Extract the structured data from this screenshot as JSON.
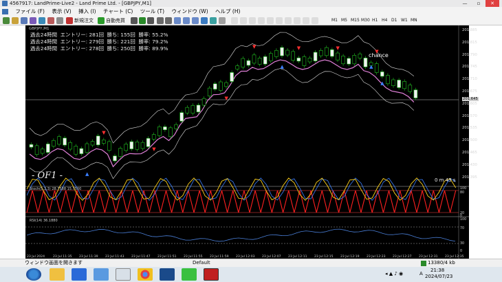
{
  "window": {
    "title": "4567917: LandPrime-Live2 - Land Prime Ltd. - [GBPJPY,M1]",
    "minimize": "—",
    "maximize": "▫",
    "close": "✕"
  },
  "menu": [
    "ファイル (F)",
    "表示 (V)",
    "挿入 (I)",
    "チャート (C)",
    "ツール (T)",
    "ウィンドウ (W)",
    "ヘルプ (H)"
  ],
  "toolbar": {
    "new_order": "新規注文",
    "auto_trade": "自動売買",
    "timeframes": [
      "M1",
      "M5",
      "M15",
      "M30",
      "H1",
      "H4",
      "D1",
      "W1",
      "MN"
    ]
  },
  "chart": {
    "symbol_label": "GBPJPY,M1",
    "stats": [
      "過去24時間  エントリー: 281回  勝ち: 155回  勝率: 55.2%",
      "過去24時間  エントリー: 279回  勝ち: 221回  勝率: 79.2%",
      "過去24時間  エントリー: 278回  勝ち: 250回  勝率: 89.9%"
    ],
    "chance_label": "chance",
    "watermark": "- OF1 -",
    "countdown": "0 m 43 s",
    "current_price": "201.645",
    "price_ticks": [
      "201.885",
      "201.815",
      "201.790",
      "201.745",
      "201.710",
      "201.675",
      "201.605",
      "201.570",
      "201.535",
      "201.500",
      "201.465",
      "201.430",
      "201.395"
    ],
    "stoch_label": "Stoch(5,3,3) 28.7588 15.7500",
    "stoch_ticks": [
      "100",
      "80",
      "20",
      "0"
    ],
    "rsi_label": "RSI(14) 36.1880",
    "rsi_ticks": [
      "100",
      "70",
      "30",
      "0"
    ],
    "time_ticks": [
      "23 Jul 2024",
      "23 Jul 11:35",
      "23 Jul 11:39",
      "23 Jul 11:43",
      "23 Jul 11:47",
      "23 Jul 11:51",
      "23 Jul 11:55",
      "23 Jul 11:59",
      "23 Jul 12:03",
      "23 Jul 12:07",
      "23 Jul 12:11",
      "23 Jul 12:15",
      "23 Jul 12:19",
      "23 Jul 12:23",
      "23 Jul 12:27",
      "23 Jul 12:31",
      "23 Jul 12:35"
    ]
  },
  "status": {
    "left": "ウィンドウ画面を開きます",
    "profile": "Default",
    "traffic": "13380/4 kb"
  },
  "taskbar": {
    "time": "21:38",
    "date": "2024/07/23",
    "lang": "A"
  },
  "colors": {
    "candle_up": "#22c522",
    "candle_down": "#f0f0f0",
    "bollinger": "#e0e0e0",
    "ma_pink": "#e080d8",
    "stoch_main": "#ffd21a",
    "stoch_signal": "#3a7fff",
    "stoch_zig": "#ff2020",
    "rsi": "#4a7fd8"
  }
}
